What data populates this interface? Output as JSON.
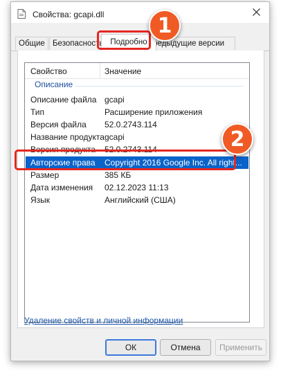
{
  "window": {
    "title": "Свойства: gcapi.dll",
    "close_icon": "close-icon",
    "file_icon": "document-icon"
  },
  "tabs": [
    {
      "label": "Общие"
    },
    {
      "label": "Безопасность"
    },
    {
      "label": "Подробно"
    },
    {
      "label": "Предыдущие версии"
    }
  ],
  "details": {
    "col_property": "Свойство",
    "col_value": "Значение",
    "group": "Описание",
    "rows": [
      {
        "property": "Описание файла",
        "value": "gcapi"
      },
      {
        "property": "Тип",
        "value": "Расширение приложения"
      },
      {
        "property": "Версия файла",
        "value": "52.0.2743.114"
      },
      {
        "property": "Название продукта",
        "value": "gcapi"
      },
      {
        "property": "Версия продукта",
        "value": "52.0.2743.114"
      },
      {
        "property": "Авторские права",
        "value": "Copyright 2016 Google Inc. All right..."
      },
      {
        "property": "Размер",
        "value": "385 КБ"
      },
      {
        "property": "Дата изменения",
        "value": "02.12.2023 11:13"
      },
      {
        "property": "Язык",
        "value": "Английский (США)"
      }
    ]
  },
  "link": "Удаление свойств и личной информации",
  "buttons": {
    "ok": "ОК",
    "cancel": "Отмена",
    "apply": "Применить"
  },
  "annotations": {
    "badge_1": "1",
    "badge_2": "2",
    "badge_color": "#f05a24",
    "highlight_color": "#e52620",
    "selection_color": "#0a63c9"
  }
}
